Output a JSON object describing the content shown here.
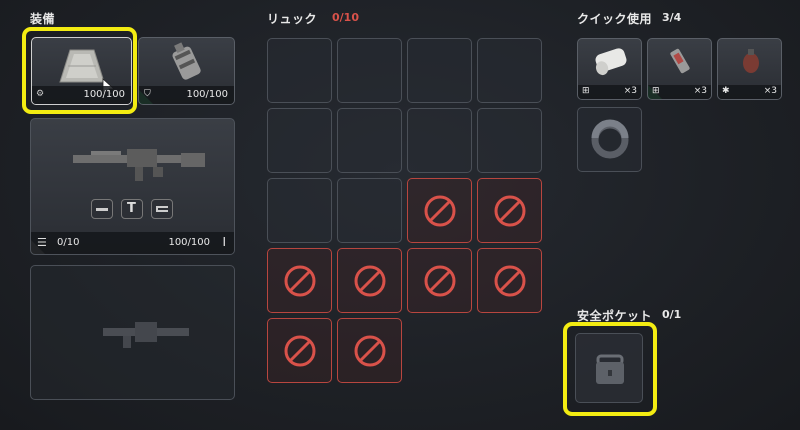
{
  "equipment": {
    "title": "装備",
    "armor_durability": "100/100",
    "helmet_durability": "100/100",
    "weapon": {
      "ammo": "0/10",
      "durability": "100/100"
    }
  },
  "backpack": {
    "title": "リュック",
    "count": "0/10"
  },
  "quick_use": {
    "title": "クイック使用",
    "count": "3/4",
    "items": [
      {
        "name": "bandage",
        "qty": "×3"
      },
      {
        "name": "syringe",
        "qty": "×3"
      },
      {
        "name": "grenade",
        "qty": "×3"
      }
    ]
  },
  "safe_pocket": {
    "title": "安全ポケット",
    "count": "0/1"
  },
  "colors": {
    "accent_highlight": "#f3ec12",
    "locked_red": "#d9524a",
    "rarity_green": "#3fb56b"
  }
}
